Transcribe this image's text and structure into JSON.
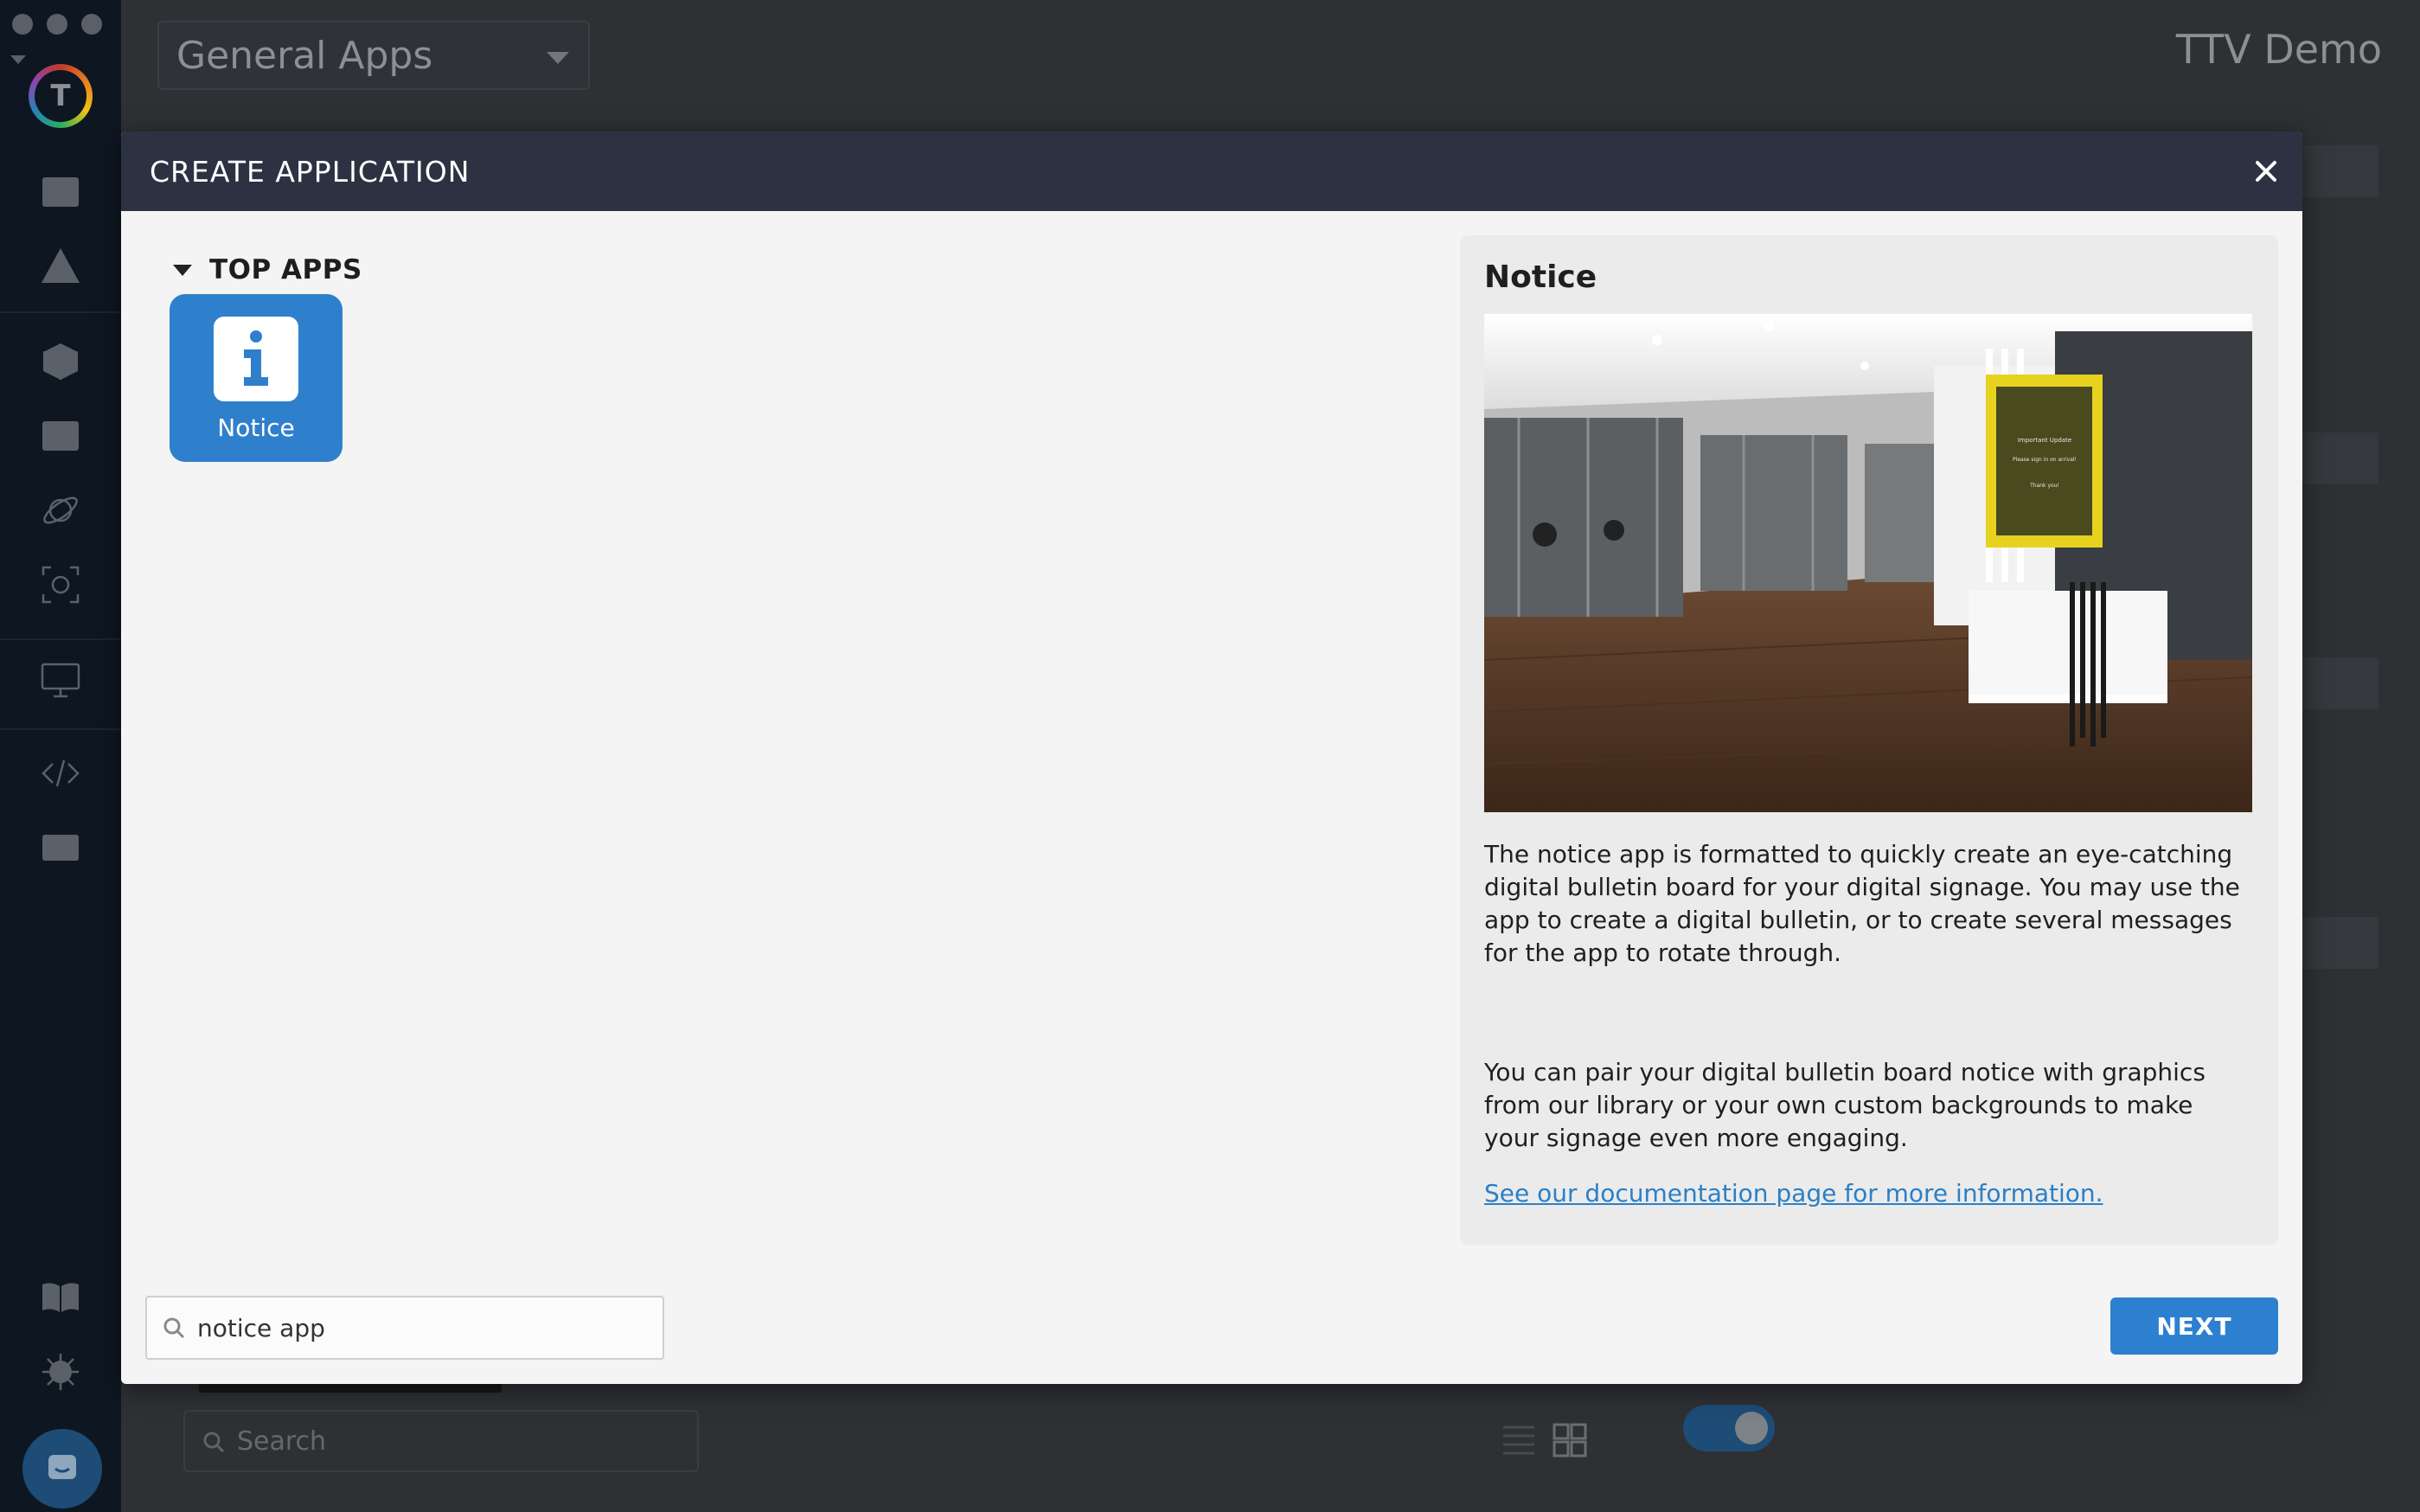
{
  "background": {
    "app_select_value": "General Apps",
    "account_title": "TTV Demo",
    "search_placeholder": "Search",
    "logo_letter": "T"
  },
  "modal": {
    "title": "CREATE APPLICATION",
    "group_label": "TOP APPS",
    "apps": [
      {
        "label": "Notice",
        "icon": "info-icon",
        "selected": true
      }
    ],
    "details": {
      "title": "Notice",
      "image_sign_text": [
        "Important Update",
        "Please sign in on arrival!",
        "Thank you!"
      ],
      "paragraph_1": "The notice app is formatted to quickly create an eye-catching digital bulletin board for your digital signage. You may use the app to create a digital bulletin, or to create several messages for the app to rotate through.",
      "paragraph_2": "You can pair your digital bulletin board notice with graphics from our library or your own custom backgrounds to make your signage even more engaging.",
      "link_text": "See our documentation page for more information."
    },
    "search": {
      "value": "notice app"
    },
    "next_label": "NEXT"
  },
  "colors": {
    "header": "#2c3242",
    "primary": "#2d80cf",
    "modal_bg": "#f4f4f4",
    "panel_bg": "#ebebeb",
    "link": "#2c7fc6"
  }
}
